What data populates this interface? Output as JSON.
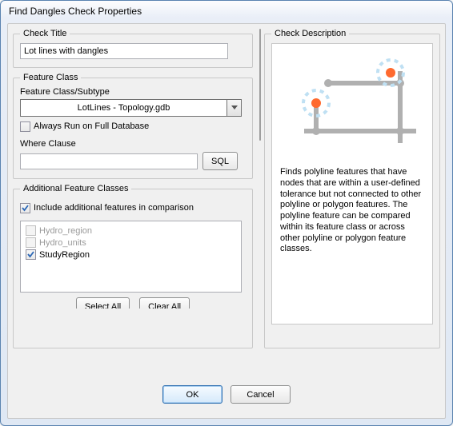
{
  "window": {
    "title": "Find Dangles Check Properties"
  },
  "checkTitle": {
    "legend": "Check Title",
    "value": "Lot lines with dangles"
  },
  "featureClass": {
    "legend": "Feature Class",
    "label": "Feature Class/Subtype",
    "selected": "LotLines  -  Topology.gdb",
    "alwaysRun": {
      "checked": false,
      "label": "Always Run on Full Database"
    },
    "whereLabel": "Where Clause",
    "whereValue": "",
    "sqlLabel": "SQL"
  },
  "additional": {
    "legend": "Additional Feature Classes",
    "include": {
      "checked": true,
      "label": "Include additional features in comparison"
    },
    "items": [
      {
        "label": "Hydro_region",
        "checked": false,
        "enabled": false
      },
      {
        "label": "Hydro_units",
        "checked": false,
        "enabled": false
      },
      {
        "label": "StudyRegion",
        "checked": true,
        "enabled": true
      }
    ],
    "selectAll": "Select All",
    "clearAll": "Clear All"
  },
  "description": {
    "legend": "Check Description",
    "text": "Finds polyline features that have nodes that are within a user-defined tolerance but not connected to other polyline or polygon features.  The polyline feature can be compared within its feature class or across other polyline or polygon feature classes."
  },
  "buttons": {
    "ok": "OK",
    "cancel": "Cancel"
  }
}
